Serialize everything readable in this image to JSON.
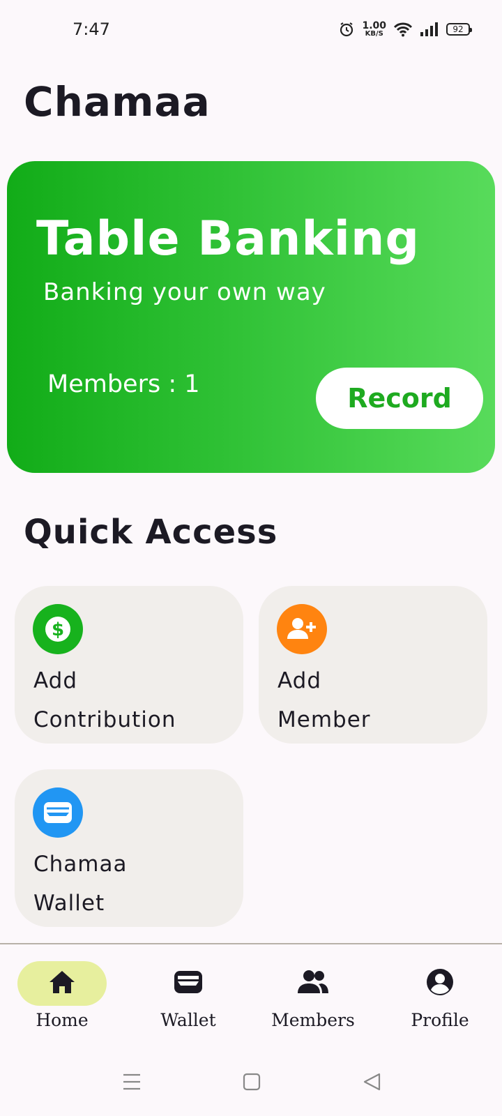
{
  "status_bar": {
    "time": "7:47",
    "net_speed_value": "1.00",
    "net_speed_unit": "KB/S",
    "battery": "92",
    "icons": [
      "alarm-icon",
      "wifi-icon",
      "signal-icon",
      "battery-icon"
    ]
  },
  "app": {
    "title": "Chamaa"
  },
  "hero": {
    "title": "Table Banking",
    "subtitle": "Banking your own way",
    "members": "Members : 1",
    "record_label": "Record",
    "gradient_colors": [
      "#12ac18",
      "#58db5b"
    ]
  },
  "quick_access": {
    "title": "Quick Access",
    "tiles": [
      {
        "line1": "Add",
        "line2": "Contribution",
        "icon": "dollar-icon",
        "color": "#17b21d"
      },
      {
        "line1": "Add",
        "line2": "Member",
        "icon": "add-person-icon",
        "color": "#ff8410"
      },
      {
        "line1": "Chamaa",
        "line2": "Wallet",
        "icon": "wallet-icon",
        "color": "#2196f3"
      }
    ]
  },
  "bottom_nav": {
    "items": [
      {
        "label": "Home",
        "icon": "home-icon",
        "active": true
      },
      {
        "label": "Wallet",
        "icon": "wallet-icon",
        "active": false
      },
      {
        "label": "Members",
        "icon": "group-icon",
        "active": false
      },
      {
        "label": "Profile",
        "icon": "account-icon",
        "active": false
      }
    ],
    "active_color": "#e7ef9e"
  },
  "system_nav": {
    "icons": [
      "menu-icon",
      "square-icon",
      "back-triangle-icon"
    ]
  }
}
